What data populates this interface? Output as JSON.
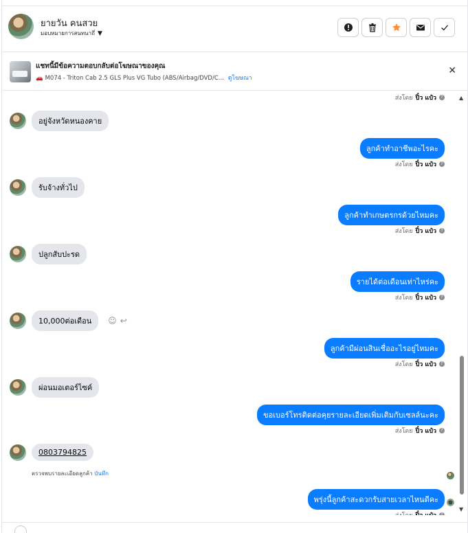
{
  "header": {
    "contact_name": "ยายวัน คนสวย",
    "assign_label": "มอบหมายการสนทนาถึ่"
  },
  "actions": [
    {
      "name": "mark-spam-button",
      "icon": "exclamation-icon"
    },
    {
      "name": "delete-button",
      "icon": "trash-icon"
    },
    {
      "name": "star-button",
      "icon": "star-icon"
    },
    {
      "name": "mark-unread-button",
      "icon": "envelope-icon"
    },
    {
      "name": "mark-done-button",
      "icon": "check-icon"
    }
  ],
  "ad": {
    "title": "แชทนี้มีข้อความตอบกลับต่อโฆษณาของคุณ",
    "subtitle": "M074 - Triton Cab 2.5 GLS Plus VG Tubo (ABS/Airbag/DVD/C...",
    "link": "ดูโฆษณา"
  },
  "sent_by_label": "ส่งโดย",
  "sender": "ปิ๋ว แป๋ว",
  "messages": [
    {
      "dir": "out-status"
    },
    {
      "dir": "in",
      "text": "อยู่จังหวัดหนองคาย"
    },
    {
      "dir": "out",
      "text": "ลูกค้าทำอาชีพอะไรคะ"
    },
    {
      "dir": "in",
      "text": "รับจ้างทั่วไป"
    },
    {
      "dir": "out",
      "text": "ลูกค้าทำเกษตรกรด้วยไหมคะ"
    },
    {
      "dir": "in",
      "text": "ปลูกสับปะรด"
    },
    {
      "dir": "out",
      "text": "รายได้ต่อเดือนเท่าไหร่คะ"
    },
    {
      "dir": "in",
      "text": "10,000ต่อเดือน"
    },
    {
      "dir": "out",
      "text": "ลูกค้ามีผ่อนสินเชื่ออะไรอยู่ไหมคะ"
    },
    {
      "dir": "in",
      "text": "ผ่อนมอเตอร์ไซค์"
    },
    {
      "dir": "out",
      "text": "ขอเบอร์โทรติดต่อคุยรายละเอียดเพิ่มเติมกับเซลล์นะคะ"
    },
    {
      "dir": "in",
      "text": "0803794825"
    },
    {
      "dir": "out",
      "text": "พรุ่งนี้ลูกค้าสะดวกรับสายเวลาไหนดีคะ"
    }
  ],
  "phone_note": {
    "text": "ตรวจพบรายละเอียดลูกค้า",
    "link": "บันทึก"
  },
  "colors": {
    "outgoing_bubble": "#0a7cff",
    "incoming_bubble": "#e4e6eb",
    "link": "#1877f2",
    "star": "#f7923a"
  }
}
